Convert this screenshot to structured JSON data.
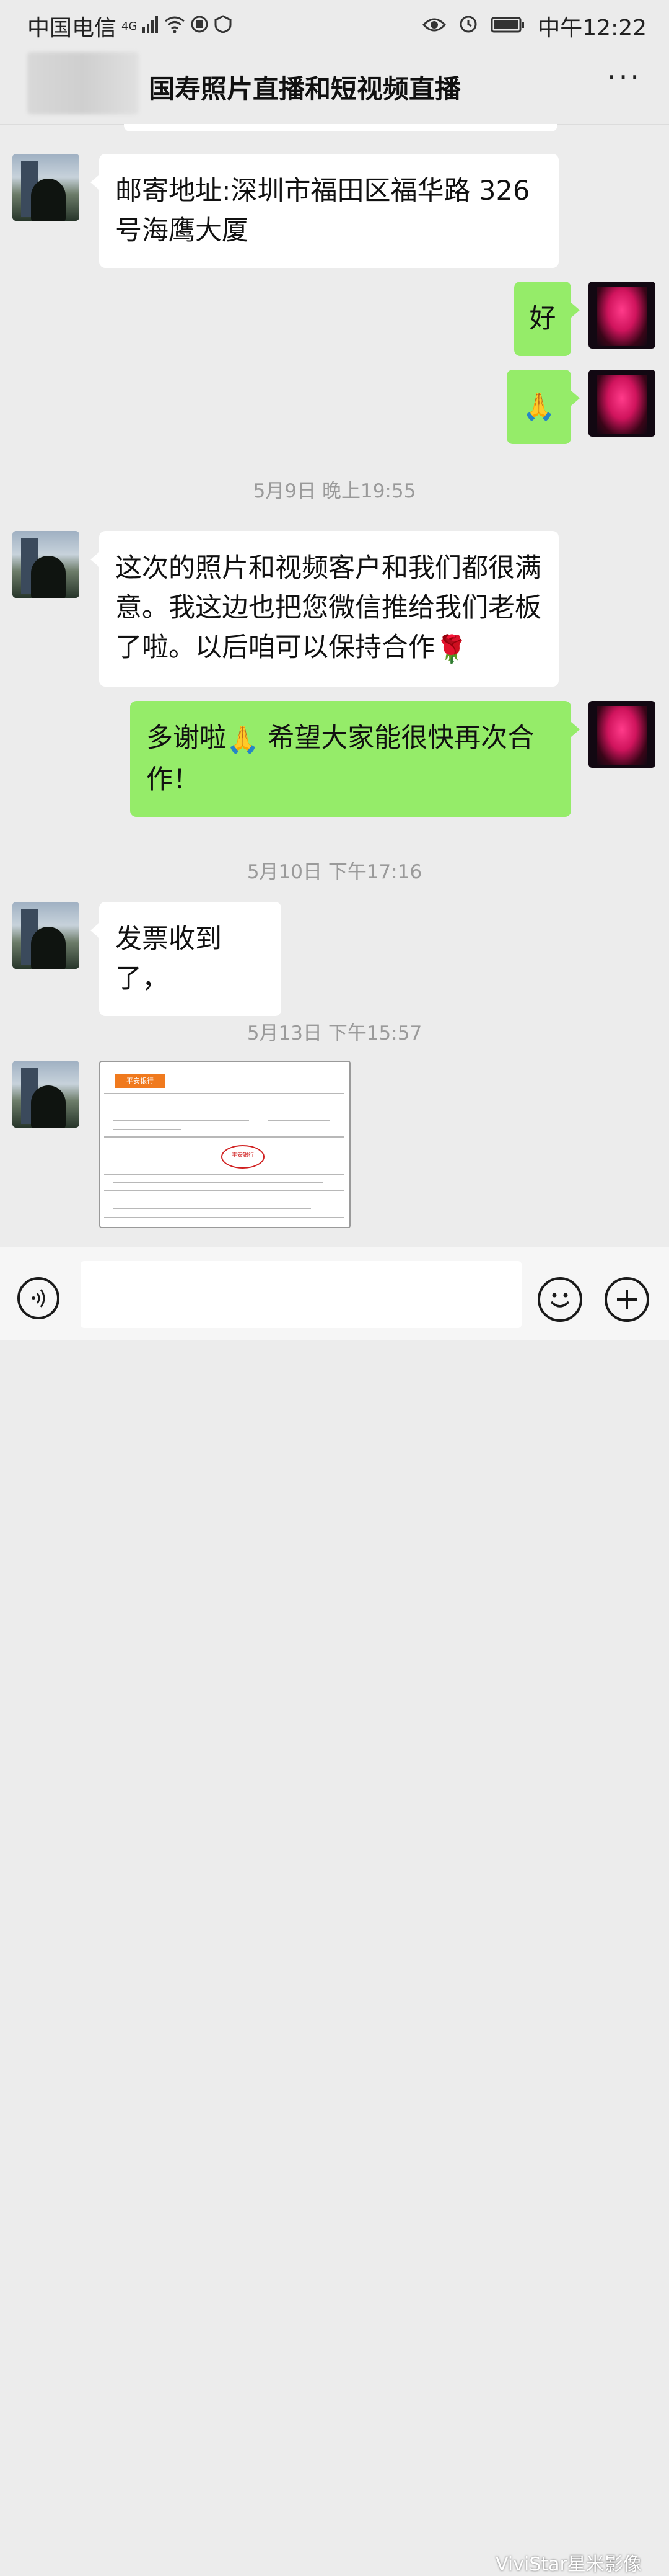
{
  "status_bar": {
    "carrier": "中国电信",
    "network": "4G",
    "time": "中午12:22"
  },
  "header": {
    "title": "国寿照片直播和短视频直播",
    "more": "···"
  },
  "messages": [
    {
      "side": "in",
      "text": "邮寄地址:深圳市福田区福华路 326 号海鹰大厦"
    },
    {
      "side": "out",
      "text": "好"
    },
    {
      "side": "out",
      "text": "🙏"
    },
    {
      "timestamp": "5月9日 晚上19:55"
    },
    {
      "side": "in",
      "text": "这次的照片和视频客户和我们都很满意。我这边也把您微信推给我们老板了啦。以后咱可以保持合作",
      "emoji": "🌹"
    },
    {
      "side": "out",
      "text_before": "多谢啦",
      "emoji": "🙏",
      "text_after": " 希望大家能很快再次合作！"
    },
    {
      "timestamp": "5月10日 下午17:16"
    },
    {
      "side": "in",
      "text": "发票收到了，"
    },
    {
      "timestamp": "5月13日 下午15:57"
    },
    {
      "side": "in",
      "type": "image",
      "bank_name": "平安银行",
      "stamp_text": "平安银行"
    }
  ],
  "input_bar": {
    "watermark": "ViviStar星米影像"
  },
  "icons": {
    "voice": "voice-icon",
    "emoji": "emoji-icon",
    "plus": "plus-icon",
    "eye": "eye-icon",
    "alarm": "alarm-icon",
    "battery": "battery-icon",
    "wifi": "wifi-icon",
    "signal": "signal-icon"
  }
}
